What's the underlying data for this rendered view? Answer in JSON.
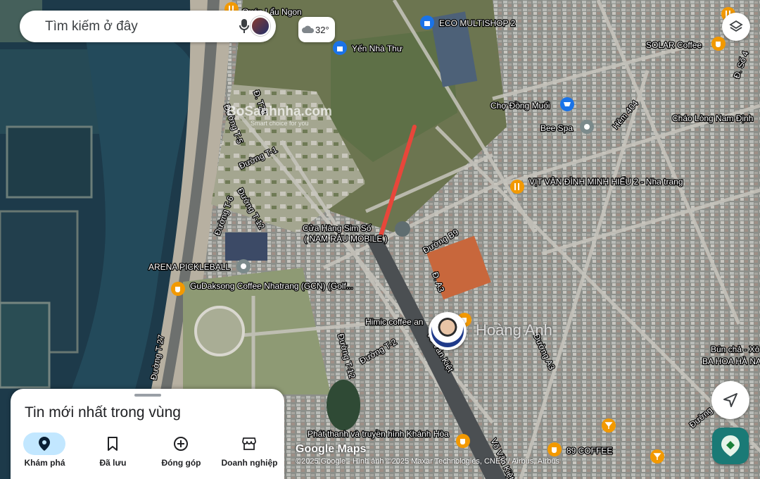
{
  "search": {
    "placeholder": "Tìm kiếm ở đây",
    "mic_icon": "mic-icon",
    "account_icon": "account-avatar-icon"
  },
  "weather": {
    "icon": "cloud-icon",
    "temperature": "32°"
  },
  "map": {
    "places": [
      {
        "name": "Quán Lẩu Ngon",
        "type": "restaurant"
      },
      {
        "name": "ECO MULTISHOP 2",
        "type": "shopping"
      },
      {
        "name": "Yến Nhà Thư",
        "type": "shopping"
      },
      {
        "name": "SOLAR Coffee",
        "type": "cafe"
      },
      {
        "name": "Chợ Đồng Muối",
        "type": "shopping"
      },
      {
        "name": "Bee Spa",
        "type": "spa"
      },
      {
        "name": "Cháo Lòng Nam Định",
        "type": "restaurant"
      },
      {
        "name": "VỊT VÂN ĐÌNH MINH HIẾU 2 - Nha trang",
        "type": "restaurant"
      },
      {
        "name": "Cửa Hàng Sim Số",
        "type": "shopping"
      },
      {
        "name": "( NAM RÂU MOBILE )",
        "type": "shopping"
      },
      {
        "name": "ARENA PICKLEBALL",
        "type": "sports"
      },
      {
        "name": "GuDaksong Coffee Nhatrang (GCN) (Golf...",
        "type": "cafe"
      },
      {
        "name": "Himic coffee an",
        "type": "cafe"
      },
      {
        "name": "89 COFFEE",
        "type": "cafe"
      },
      {
        "name": "Phát thanh và truyền hình Khánh Hòa",
        "type": "building"
      },
      {
        "name": "BA HOA HÀ NA",
        "type": "shopping"
      },
      {
        "name": "Bún chả - Xô",
        "type": "restaurant"
      }
    ],
    "streets": [
      "Đ. T28",
      "Đường T-5",
      "Đường T-1",
      "Đường T-6",
      "Đường T-12",
      "Đường B9",
      "Đ. A3",
      "Hẻm 404",
      "Võ Văn Kiệt",
      "Đường A3",
      "Đường T-2",
      "Đường T-27",
      "Đ. Số 4",
      "Đường",
      "Đường T-12",
      "Võ Văn Kiệt"
    ],
    "avatar": {
      "name": "Hoàng Anh"
    },
    "watermark": {
      "brand": "BoSanhnha.com",
      "tagline": "Smart choice for you"
    },
    "accent_colors": {
      "route_line": "#e8463a",
      "cafe_pin": "#f29900",
      "shop_pin": "#1a73e8",
      "place_pin": "#7b8a8b"
    }
  },
  "sheet": {
    "title": "Tin mới nhất trong vùng",
    "tabs": [
      {
        "label": "Khám phá",
        "icon": "location-pin-icon",
        "active": true
      },
      {
        "label": "Đã lưu",
        "icon": "bookmark-icon",
        "active": false
      },
      {
        "label": "Đóng góp",
        "icon": "add-circle-icon",
        "active": false
      },
      {
        "label": "Doanh nghiệp",
        "icon": "storefront-icon",
        "active": false
      }
    ]
  },
  "attribution": {
    "logo": "Google Maps",
    "text": "©2025 Google - Hình ảnh ©2025 Maxar Technologies, CNES / Airbus, Airbus"
  },
  "buttons": {
    "layers_icon": "layers-icon",
    "navigate_icon": "navigation-arrow-icon",
    "quick_icon": "quick-access-icon"
  }
}
